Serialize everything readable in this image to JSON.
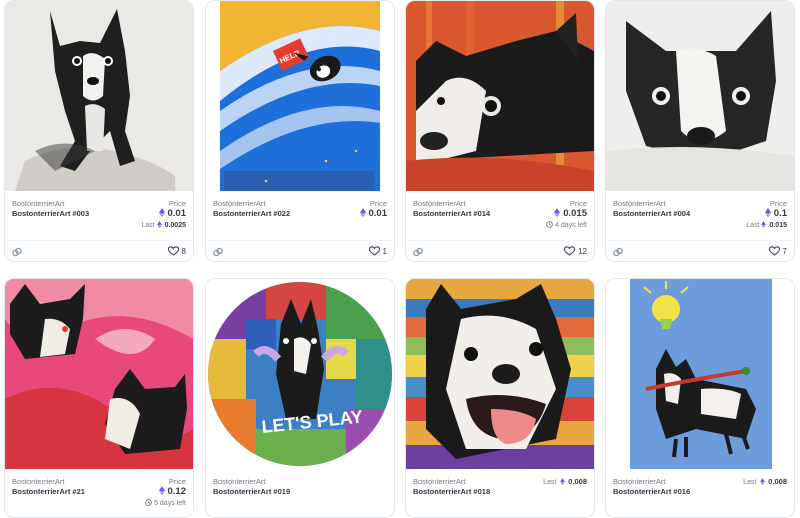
{
  "cards": [
    {
      "collection": "BostonterrierArt",
      "name": "BostonterrierArt #003",
      "price_label": "Price",
      "price": "0.01",
      "last_label": "Last",
      "last": "0.0025",
      "likes": "8"
    },
    {
      "collection": "BostonterrierArt",
      "name": "BostonterrierArt #022",
      "price_label": "Price",
      "price": "0.01",
      "likes": "1"
    },
    {
      "collection": "BostonterrierArt",
      "name": "BostonterrierArt #014",
      "price_label": "Price",
      "price": "0.015",
      "time_left": "4 days left",
      "likes": "12"
    },
    {
      "collection": "BostonterrierArt",
      "name": "BostonterrierArt #004",
      "price_label": "Price",
      "price": "0.1",
      "last_label": "Last",
      "last": "0.015",
      "likes": "7"
    },
    {
      "collection": "BostonterrierArt",
      "name": "BostonterrierArt #21",
      "price_label": "Price",
      "price": "0.12",
      "time_left": "5 days left"
    },
    {
      "collection": "BostonterrierArt",
      "name": "BostonterrierArt #019"
    },
    {
      "collection": "BostonterrierArt",
      "name": "BostonterrierArt #018",
      "last_label": "Last",
      "last": "0.008"
    },
    {
      "collection": "BostonterrierArt",
      "name": "BostonterrierArt #016",
      "last_label": "Last",
      "last": "0.008"
    }
  ],
  "artwork_text": {
    "help_sign": "HELP",
    "lets_play": "LET'S PLAY"
  },
  "icons": {
    "currency": "eth-icon",
    "link": "link-icon",
    "favorite": "heart-icon",
    "timer": "clock-icon"
  },
  "colors": {
    "eth": "#6f5ad9",
    "muted": "#707a83",
    "text": "#353840",
    "border": "#e5e8eb"
  }
}
